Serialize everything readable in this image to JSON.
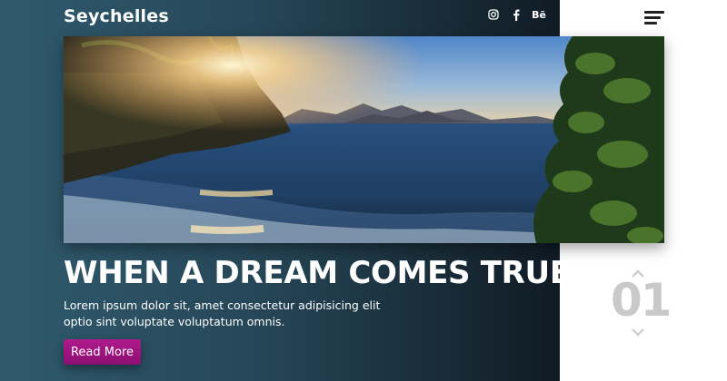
{
  "brand": {
    "name": "Seychelles"
  },
  "social": {
    "icons": [
      "instagram-icon",
      "facebook-icon",
      "behance-icon"
    ],
    "behance_label": "Bē"
  },
  "hero": {
    "headline": "WHEN A DREAM COMES TRUE",
    "description": "Lorem ipsum dolor sit, amet consectetur adipisicing elit optio sint voluptate voluptatum omnis.",
    "cta_label": "Read More"
  },
  "slider": {
    "current": "01"
  },
  "colors": {
    "panel_gradient_start": "#2f5a6d",
    "panel_gradient_end": "#101b24",
    "cta": "#a0147f",
    "slide_number": "#c9c9c9"
  }
}
